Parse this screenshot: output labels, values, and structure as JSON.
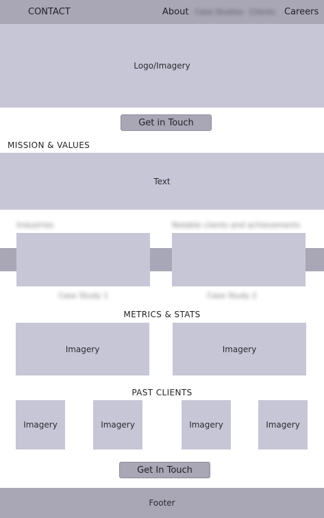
{
  "nav": {
    "contact": "CONTACT",
    "about": "About",
    "blurred_1": "Case Studies",
    "blurred_2": "Clients",
    "careers": "Careers"
  },
  "hero": {
    "label": "Logo/Imagery"
  },
  "cta_top": {
    "label": "Get in Touch"
  },
  "mission": {
    "title": "MISSION & VALUES",
    "text": "Text"
  },
  "case_studies": {
    "header_left": "Industries",
    "header_right": "Notable clients and achievements",
    "caption_left": "Case Study 1",
    "caption_right": "Case Study 2"
  },
  "metrics": {
    "title": "METRICS & STATS",
    "left": "Imagery",
    "right": "Imagery"
  },
  "clients": {
    "title": "PAST CLIENTS",
    "items": [
      "Imagery",
      "Imagery",
      "Imagery",
      "Imagery"
    ]
  },
  "cta_bottom": {
    "label": "Get In Touch"
  },
  "footer": {
    "label": "Footer"
  }
}
